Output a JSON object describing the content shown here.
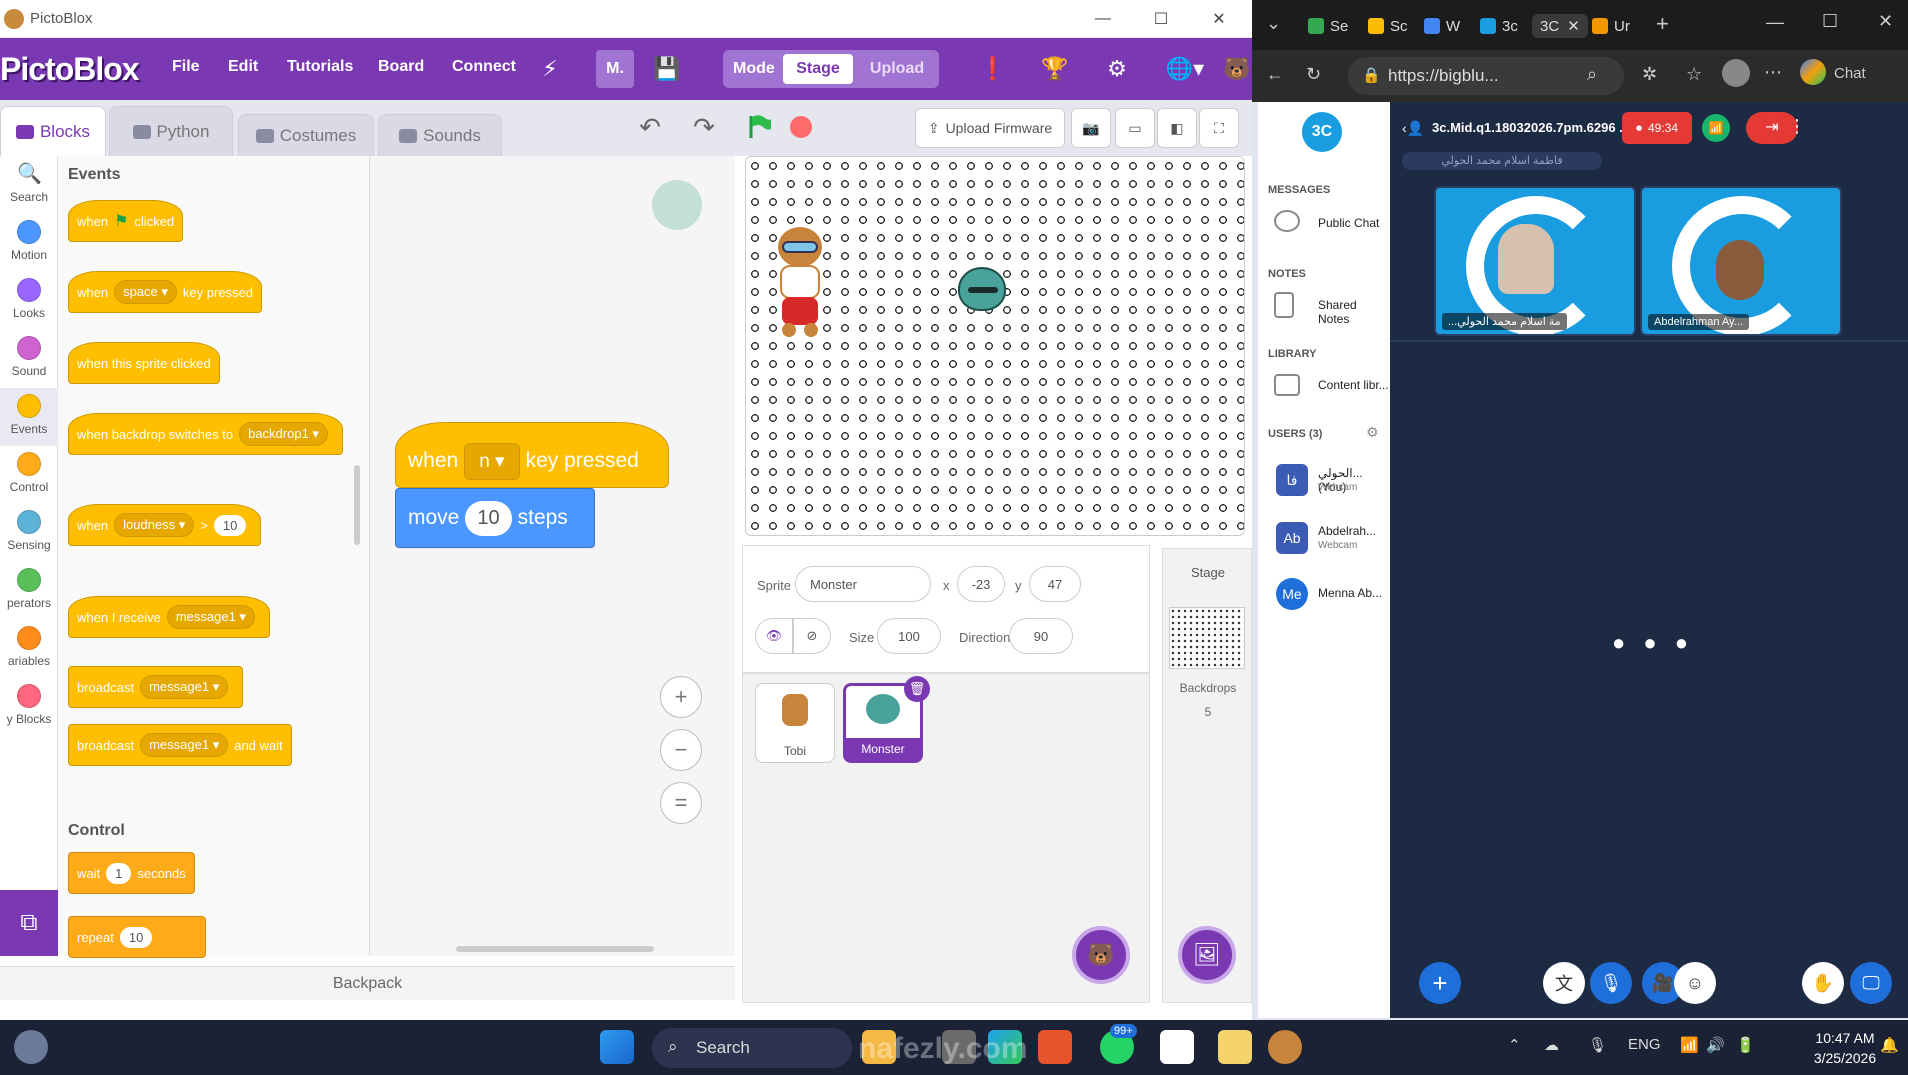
{
  "pictoblox": {
    "window_title": "PictoBlox",
    "brand": "PictoBlox",
    "menu": [
      "File",
      "Edit",
      "Tutorials",
      "Board",
      "Connect"
    ],
    "user_initial": "M.",
    "mode": {
      "label": "Mode",
      "stage": "Stage",
      "upload": "Upload"
    },
    "tabs": {
      "blocks": "Blocks",
      "python": "Python",
      "costumes": "Costumes",
      "sounds": "Sounds"
    },
    "categories": [
      {
        "label": "Search",
        "color": "#3b82f6"
      },
      {
        "label": "Motion",
        "color": "#4c97ff"
      },
      {
        "label": "Looks",
        "color": "#9966ff"
      },
      {
        "label": "Sound",
        "color": "#cf63cf"
      },
      {
        "label": "Events",
        "color": "#ffbf00"
      },
      {
        "label": "Control",
        "color": "#ffab19"
      },
      {
        "label": "Sensing",
        "color": "#5cb1d6"
      },
      {
        "label": "perators",
        "color": "#59c059"
      },
      {
        "label": "ariables",
        "color": "#ff8c1a"
      },
      {
        "label": "y Blocks",
        "color": "#ff6680"
      }
    ],
    "palette": {
      "events_title": "Events",
      "control_title": "Control",
      "when_flag": {
        "a": "when",
        "b": "clicked"
      },
      "when_key": {
        "a": "when",
        "key": "space",
        "b": "key pressed"
      },
      "when_sprite": "when this sprite clicked",
      "when_backdrop": {
        "a": "when backdrop switches to",
        "v": "backdrop1"
      },
      "when_loudness": {
        "a": "when",
        "v": "loudness",
        "op": ">",
        "n": "10"
      },
      "when_receive": {
        "a": "when I receive",
        "v": "message1"
      },
      "broadcast": {
        "a": "broadcast",
        "v": "message1"
      },
      "broadcast_wait": {
        "a": "broadcast",
        "v": "message1",
        "b": "and wait"
      },
      "wait": {
        "a": "wait",
        "n": "1",
        "b": "seconds"
      },
      "repeat": {
        "a": "repeat",
        "n": "10"
      }
    },
    "script": {
      "hat": {
        "a": "when",
        "key": "n",
        "b": "key pressed"
      },
      "move": {
        "a": "move",
        "n": "10",
        "b": "steps"
      }
    },
    "backpack": "Backpack",
    "upload_firmware": "Upload Firmware",
    "sprite": {
      "label": "Sprite",
      "name": "Monster",
      "x_label": "x",
      "x": "-23",
      "y_label": "y",
      "y": "47",
      "size_label": "Size",
      "size": "100",
      "direction_label": "Direction",
      "direction": "90"
    },
    "sprites": [
      "Tobi",
      "Monster"
    ],
    "stage_panel": {
      "title": "Stage",
      "backdrops_label": "Backdrops",
      "backdrops_count": "5"
    }
  },
  "browser": {
    "tabs": [
      "Se",
      "Sc",
      "W",
      "3c",
      "3C",
      "Ur"
    ],
    "url": "https://bigblu...",
    "chat_label": "Chat",
    "meeting_title": "3c.Mid.q1.18032026.7pm.6296 ...",
    "recording_time": "49:34",
    "presenter_bar": "فاطمة اسلام محمد الحولي",
    "sidebar": {
      "logo": "3C",
      "messages_h": "MESSAGES",
      "public_chat": "Public Chat",
      "notes_h": "NOTES",
      "shared_notes": "Shared Notes",
      "library_h": "LIBRARY",
      "content_library": "Content libr...",
      "users_h": "USERS (3)",
      "users": [
        {
          "avatar": "فا",
          "name": "الحولي... (You)",
          "sub": "Webcam",
          "color": "#3b5bb5"
        },
        {
          "avatar": "Ab",
          "name": "Abdelrah...",
          "sub": "Webcam",
          "color": "#3b5bb5"
        },
        {
          "avatar": "Me",
          "name": "Menna Ab...",
          "sub": "",
          "color": "#1e6fd9"
        }
      ]
    },
    "videos": [
      "...مة اسلام محمد الحولي",
      "Abdelrahman Ay..."
    ]
  },
  "taskbar": {
    "search": "Search",
    "badge": "99+",
    "lang": "ENG",
    "time": "10:47 AM",
    "date": "3/25/2026",
    "watermark": "nafezly.com"
  }
}
